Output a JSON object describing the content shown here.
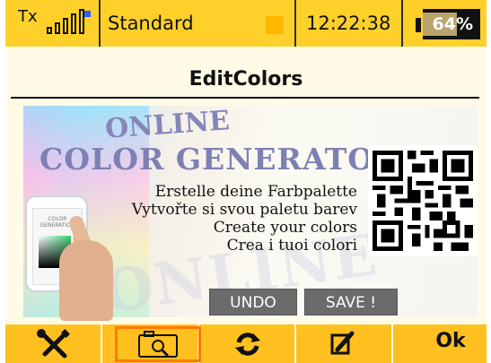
{
  "status_bar": {
    "tx_label": "Tx",
    "model_name": "Standard",
    "time": "12:22:38",
    "battery_percent": "64%",
    "battery_level": 0.64,
    "colors": {
      "bar": "#ffd02a",
      "marker": "#ffb700",
      "tx_dot": "#2f5cff"
    }
  },
  "page_title": "EditColors",
  "banner": {
    "online": "ONLINE",
    "headline": "COLOR GENERATOR",
    "lines": [
      "Erstelle deine Farbpalette",
      "Vytvořte si svou paletu barev",
      "Create your colors",
      "Crea i tuoi colori"
    ],
    "phone_title": "COLOR GENERATION",
    "watermark": "ONLINE",
    "qr_icon": "qr-code-icon"
  },
  "buttons": {
    "undo": "UNDO",
    "save": "SAVE !"
  },
  "toolbar": {
    "items": [
      {
        "icon": "tools-icon"
      },
      {
        "icon": "camera-icon",
        "selected": true
      },
      {
        "icon": "refresh-icon"
      },
      {
        "icon": "edit-icon"
      },
      {
        "label": "Ok"
      }
    ],
    "colors": {
      "bar": "#ffc020",
      "selected_outline": "#ff7a00"
    }
  }
}
